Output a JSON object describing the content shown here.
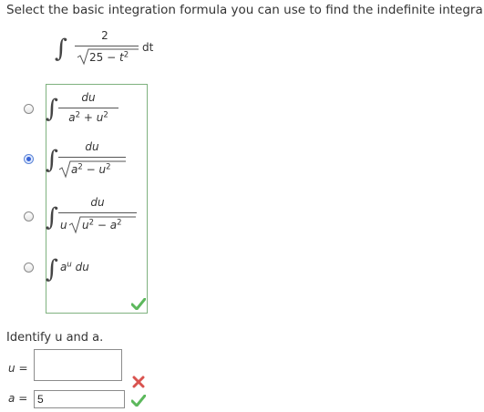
{
  "question": {
    "prompt": "Select the basic integration formula you can use to find the indefinite integral.",
    "integral": {
      "numerator": "2",
      "radicand_const": "25",
      "minus": "−",
      "radicand_var": "t",
      "radicand_exp": "2",
      "differential": "dt"
    }
  },
  "choices": [
    {
      "numerator": "du",
      "denominator": [
        "a",
        "2",
        "+",
        "u",
        "2"
      ],
      "selected": false
    },
    {
      "numerator": "du",
      "denominator": [
        "a",
        "2",
        "−",
        "u",
        "2"
      ],
      "selected": true
    },
    {
      "numerator": "du",
      "denominator": [
        "u",
        "u",
        "2",
        "−",
        "a",
        "2"
      ],
      "selected": false
    },
    {
      "body": [
        "a",
        "u",
        "du"
      ],
      "selected": false
    }
  ],
  "identify": {
    "prompt": "Identify u and a.",
    "u_label": "u",
    "u_value": "",
    "a_label": "a",
    "a_value": "5",
    "equals": "="
  },
  "feedback": {
    "choice_status": "correct",
    "u_status": "incorrect",
    "a_status": "correct",
    "correct_color": "#5cb85c",
    "incorrect_color": "#d9534f"
  }
}
